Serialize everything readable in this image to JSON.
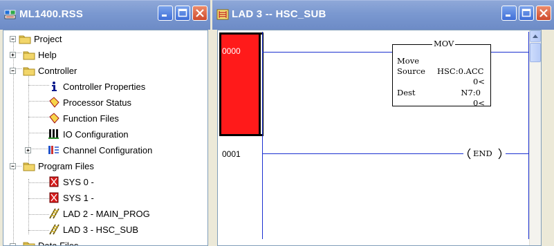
{
  "tree_window": {
    "title": "ML1400.RSS",
    "controls": {
      "minimize": "minimize",
      "maximize": "maximize",
      "close": "close"
    },
    "items": [
      {
        "label": "Project",
        "icon": "folder-icon",
        "expander": "minus"
      },
      {
        "label": "Help",
        "icon": "folder-icon",
        "expander": "plus"
      },
      {
        "label": "Controller",
        "icon": "folder-icon",
        "expander": "minus"
      },
      {
        "label": "Controller Properties",
        "icon": "info-icon"
      },
      {
        "label": "Processor Status",
        "icon": "data-file-icon"
      },
      {
        "label": "Function Files",
        "icon": "data-file-icon"
      },
      {
        "label": "IO Configuration",
        "icon": "io-config-icon"
      },
      {
        "label": "Channel Configuration",
        "icon": "channel-config-icon",
        "expander": "plus"
      },
      {
        "label": "Program Files",
        "icon": "folder-icon",
        "expander": "minus"
      },
      {
        "label": "SYS 0 -",
        "icon": "sys-file-icon"
      },
      {
        "label": "SYS 1 -",
        "icon": "sys-file-icon"
      },
      {
        "label": "LAD 2 - MAIN_PROG",
        "icon": "ladder-file-icon"
      },
      {
        "label": "LAD 3 - HSC_SUB",
        "icon": "ladder-file-icon"
      },
      {
        "label": "Data Files",
        "icon": "folder-icon",
        "expander": "minus"
      }
    ]
  },
  "ladder_window": {
    "title": "LAD 3 -- HSC_SUB",
    "controls": {
      "minimize": "minimize",
      "maximize": "maximize",
      "close": "close"
    },
    "rungs": [
      {
        "number": "0000",
        "selected": true
      },
      {
        "number": "0001"
      }
    ],
    "mov_block": {
      "name": "MOV",
      "description": "Move",
      "source_label": "Source",
      "source_value": "HSC:0.ACC",
      "source_current": "0<",
      "dest_label": "Dest",
      "dest_value": "N7:0",
      "dest_current": "0<"
    },
    "end_label": "END"
  },
  "colors": {
    "titlebar": "#7a98d0",
    "rung_selection": "#ff1a1a",
    "wire": "#1a2fd0",
    "rung_number_selected": "#ffffff"
  }
}
